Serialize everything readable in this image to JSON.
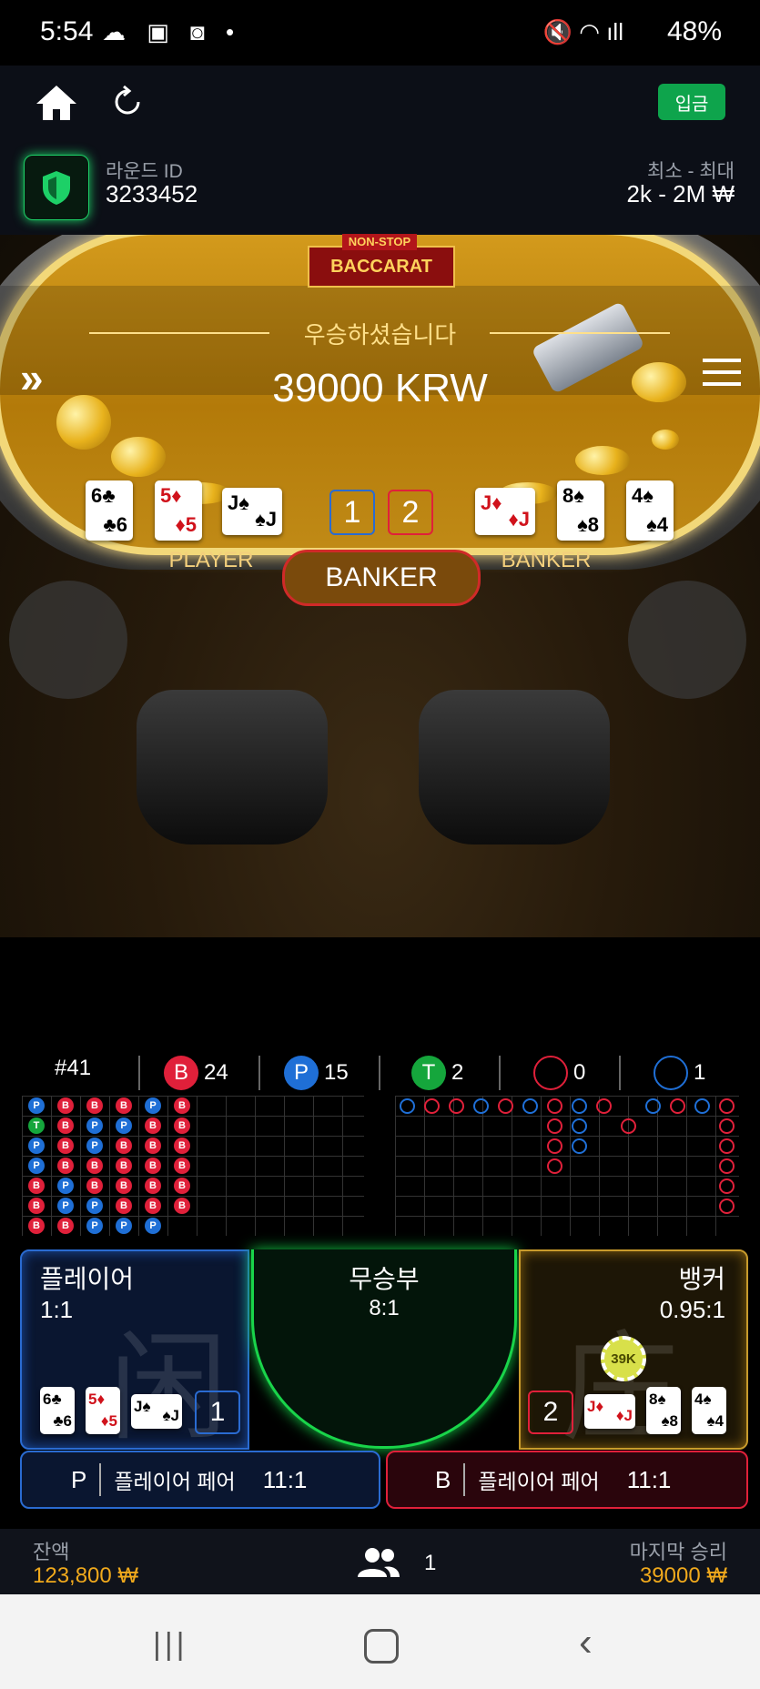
{
  "status_bar": {
    "time": "5:54",
    "battery": "48%"
  },
  "header": {
    "deposit_label": "입금"
  },
  "round": {
    "id_label": "라운드 ID",
    "id_value": "3233452",
    "limit_label": "최소 - 최대",
    "limit_value": "2k - 2M ₩"
  },
  "table": {
    "logo_top": "NON-STOP",
    "logo_main": "BACCARAT",
    "win_title": "우승하셨습니다",
    "win_amount": "39000 KRW",
    "player_label": "PLAYER",
    "banker_label": "BANKER",
    "result_label": "BANKER",
    "player_score": "1",
    "banker_score": "2",
    "player_cards": [
      "6♣",
      "5♦",
      "J♠"
    ],
    "banker_cards": [
      "J♦",
      "8♠",
      "4♠"
    ]
  },
  "stats": {
    "shoe": "#41",
    "banker_count": "24",
    "player_count": "15",
    "tie_count": "2",
    "banker_pair_count": "0",
    "player_pair_count": "1",
    "b": "B",
    "p": "P",
    "t": "T"
  },
  "bead_road": [
    [
      "P",
      "T",
      "P",
      "P",
      "B",
      "B",
      "B"
    ],
    [
      "B",
      "B",
      "B",
      "B",
      "P",
      "P",
      "B"
    ],
    [
      "B",
      "P",
      "P",
      "B",
      "B",
      "P",
      "P"
    ],
    [
      "B",
      "P",
      "B",
      "B",
      "B",
      "B",
      "P"
    ],
    [
      "P",
      "B",
      "B",
      "B",
      "B",
      "B",
      "P"
    ],
    [
      "B",
      "B",
      "B",
      "B",
      "B",
      "B",
      ""
    ]
  ],
  "bets": {
    "player_name": "플레이어",
    "player_odds": "1:1",
    "player_char": "闲",
    "player_score": "1",
    "tie_name": "무승부",
    "tie_odds": "8:1",
    "banker_name": "뱅커",
    "banker_odds": "0.95:1",
    "banker_char": "庄",
    "banker_score": "2",
    "chip": "39K",
    "player_pair_letter": "P",
    "player_pair_label": "플레이어 페어",
    "player_pair_odds": "11:1",
    "banker_pair_letter": "B",
    "banker_pair_label": "플레이어 페어",
    "banker_pair_odds": "11:1"
  },
  "footer": {
    "balance_label": "잔액",
    "balance_value": "123,800 ₩",
    "players": "1",
    "last_win_label": "마지막 승리",
    "last_win_value": "39000 ₩"
  }
}
